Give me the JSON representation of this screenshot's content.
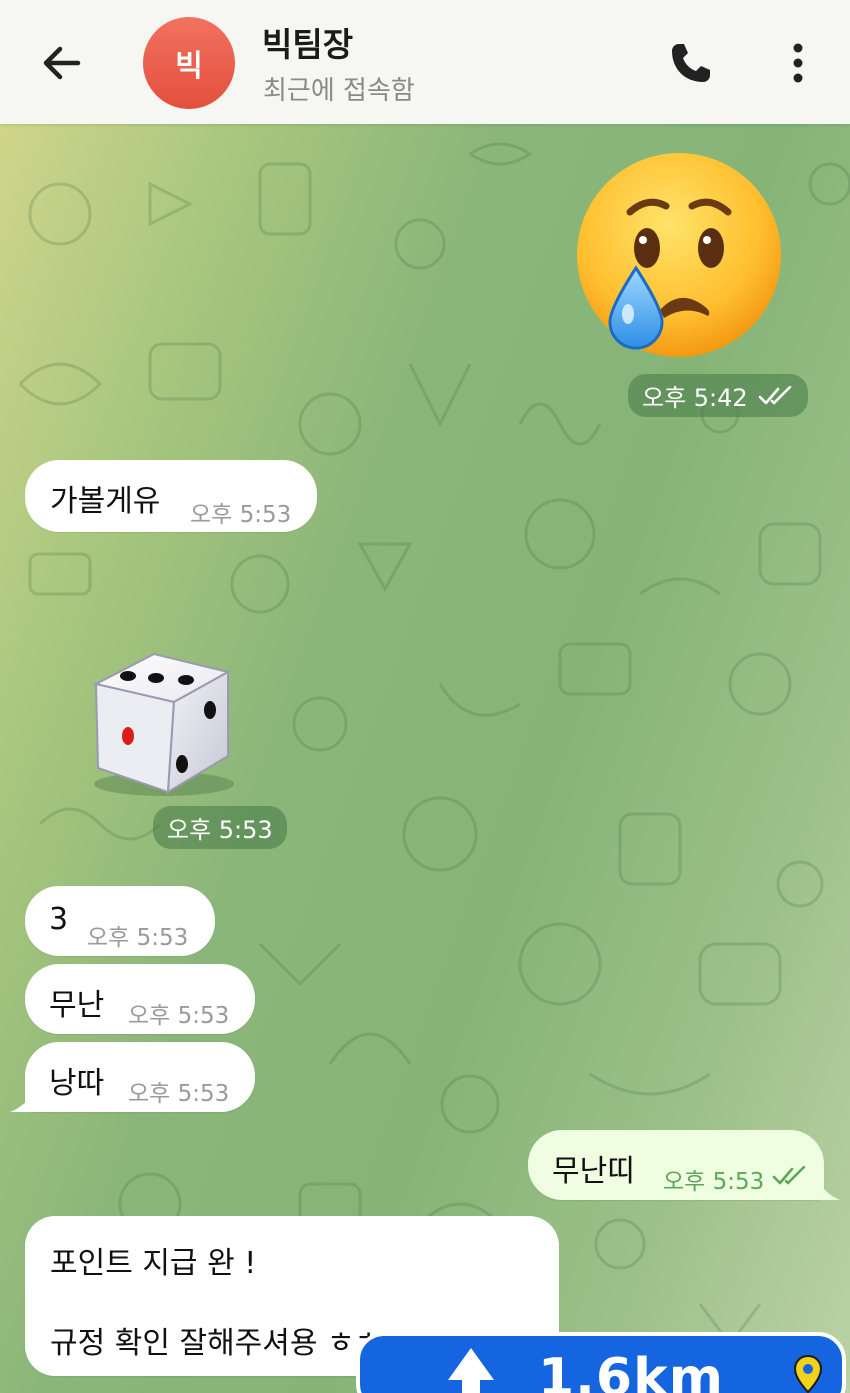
{
  "header": {
    "avatar_initial": "빅",
    "title": "빅팀장",
    "status": "최근에 접속함"
  },
  "messages": [
    {
      "id": "m1",
      "type": "emoji-sticker",
      "direction": "out",
      "emoji_name": "crying-face-icon",
      "time": "오후 5:42",
      "read": true
    },
    {
      "id": "m2",
      "type": "text",
      "direction": "in",
      "text": "가볼게유",
      "time": "오후 5:53"
    },
    {
      "id": "m3",
      "type": "dice",
      "direction": "in",
      "dice_value": 3,
      "time": "오후 5:53"
    },
    {
      "id": "m4",
      "type": "text",
      "direction": "in",
      "text": "3",
      "time": "오후 5:53"
    },
    {
      "id": "m5",
      "type": "text",
      "direction": "in",
      "text": "무난",
      "time": "오후 5:53"
    },
    {
      "id": "m6",
      "type": "text",
      "direction": "in",
      "text": "낭따",
      "time": "오후 5:53"
    },
    {
      "id": "m7",
      "type": "text",
      "direction": "out",
      "text": "무난띠",
      "time": "오후 5:53",
      "read": true
    },
    {
      "id": "m8",
      "type": "text",
      "direction": "in",
      "line1": "포인트 지급 완 !",
      "line2": "규정 확인 잘해주셔용 ㅎㅎ"
    }
  ],
  "nav_overlay": {
    "distance": "1.6km",
    "direction_icon": "arrow-up-icon",
    "pin_icon": "map-pin-icon"
  },
  "colors": {
    "header_bg": "#f6f6f3",
    "avatar": "#e8604b",
    "outgoing_bubble": "#effde0",
    "incoming_bubble": "#ffffff",
    "nav_blue": "#1565e0",
    "check_green": "#5aa95a"
  }
}
